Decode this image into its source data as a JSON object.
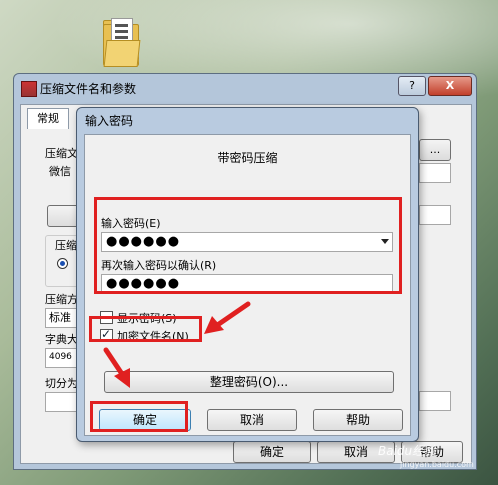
{
  "back_window": {
    "title": "压缩文件名和参数",
    "help_btn": "?",
    "close_btn": "X",
    "tab_normal": "常规",
    "label_archive": "压缩文",
    "field_archive_value": "微信",
    "label_group": "压缩",
    "label_method": "压缩方",
    "field_method_value": "标准",
    "label_dict": "字典大",
    "field_dict_value": "4096",
    "label_split": "切分为",
    "ok_label": "确定",
    "cancel_label": "取消",
    "help_label": "帮助"
  },
  "dialog": {
    "title": "输入密码",
    "heading": "带密码压缩",
    "enter_password_label": "输入密码(E)",
    "password_mask": "●●●●●●",
    "reenter_password_label": "再次输入密码以确认(R)",
    "reenter_mask": "●●●●●●",
    "show_password_label": "显示密码(S)",
    "show_password_checked": false,
    "encrypt_names_label": "加密文件名(N)",
    "encrypt_names_checked": true,
    "organize_button": "整理密码(O)...",
    "ok_button": "确定",
    "cancel_button": "取消",
    "help_button": "帮助"
  },
  "watermark": {
    "text": "Baidu经验",
    "url": "jingyan.baidu.com"
  },
  "colors": {
    "highlight": "#e02020",
    "dialog_frame": "#b9cbe0"
  }
}
